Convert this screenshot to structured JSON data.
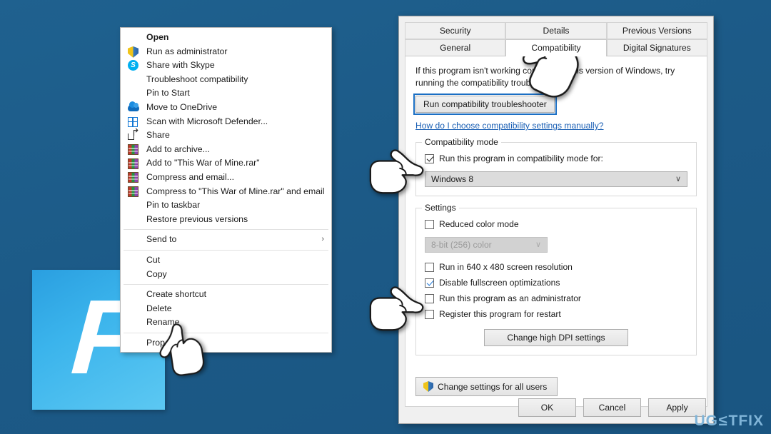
{
  "desktop": {
    "background_color": "#1d5d8b",
    "app_tile": {
      "name": "app-tile-fortnite",
      "glyph": "F",
      "color": "#3bb4ec"
    },
    "watermark": {
      "prefix": "UG",
      "mid": "≤",
      "suffix": "TFIX",
      "color": "#7fb4d8"
    }
  },
  "context_menu": {
    "items": [
      {
        "label": "Open",
        "icon": "none",
        "bold": true
      },
      {
        "label": "Run as administrator",
        "icon": "uac-shield-icon"
      },
      {
        "label": "Share with Skype",
        "icon": "skype-icon"
      },
      {
        "label": "Troubleshoot compatibility",
        "icon": "none"
      },
      {
        "label": "Pin to Start",
        "icon": "none"
      },
      {
        "label": "Move to OneDrive",
        "icon": "onedrive-cloud-icon"
      },
      {
        "label": "Scan with Microsoft Defender...",
        "icon": "defender-icon"
      },
      {
        "label": "Share",
        "icon": "share-icon"
      },
      {
        "label": "Add to archive...",
        "icon": "winrar-icon"
      },
      {
        "label": "Add to \"This War of Mine.rar\"",
        "icon": "winrar-icon"
      },
      {
        "label": "Compress and email...",
        "icon": "winrar-icon"
      },
      {
        "label": "Compress to \"This War of Mine.rar\" and email",
        "icon": "winrar-icon"
      },
      {
        "label": "Pin to taskbar",
        "icon": "none"
      },
      {
        "label": "Restore previous versions",
        "icon": "none"
      },
      {
        "separator": true
      },
      {
        "label": "Send to",
        "icon": "none",
        "submenu": "›"
      },
      {
        "separator": true
      },
      {
        "label": "Cut",
        "icon": "none"
      },
      {
        "label": "Copy",
        "icon": "none"
      },
      {
        "separator": true
      },
      {
        "label": "Create shortcut",
        "icon": "none"
      },
      {
        "label": "Delete",
        "icon": "none"
      },
      {
        "label": "Rename",
        "icon": "none"
      },
      {
        "separator": true
      },
      {
        "label": "Properties",
        "icon": "none"
      }
    ]
  },
  "dialog": {
    "tabs_row1": [
      "Security",
      "Details",
      "Previous Versions"
    ],
    "tabs_row2": [
      "General",
      "Compatibility",
      "Digital Signatures"
    ],
    "active_tab": "Compatibility",
    "intro_text": "If this program isn't working correctly on this version of Windows, try running the compatibility troubleshooter.",
    "troubleshooter_button": "Run compatibility troubleshooter",
    "manual_link": "How do I choose compatibility settings manually?",
    "compatibility_mode": {
      "legend": "Compatibility mode",
      "checkbox_label": "Run this program in compatibility mode for:",
      "checkbox_checked": true,
      "selected_os": "Windows 8",
      "dropdown_arrow": "∨"
    },
    "settings": {
      "legend": "Settings",
      "reduced_color_mode": {
        "label": "Reduced color mode",
        "checked": false
      },
      "color_depth": {
        "value": "8-bit (256) color",
        "disabled": true,
        "arrow": "∨"
      },
      "low_resolution": {
        "label": "Run in 640 x 480 screen resolution",
        "checked": false
      },
      "disable_fullscreen": {
        "label": "Disable fullscreen optimizations",
        "checked": true,
        "check_color": "#1d76d6"
      },
      "run_as_admin": {
        "label": "Run this program as an administrator",
        "checked": false
      },
      "register_restart": {
        "label": "Register this program for restart",
        "checked": false
      },
      "dpi_button": "Change high DPI settings"
    },
    "all_users_button": "Change settings for all users",
    "footer": {
      "ok": "OK",
      "cancel": "Cancel",
      "apply": "Apply"
    }
  }
}
